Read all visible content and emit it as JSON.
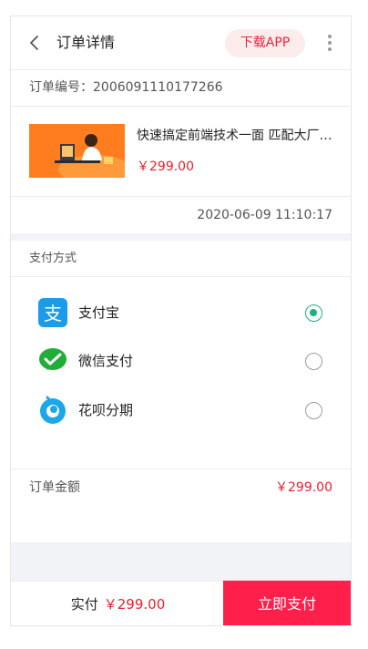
{
  "header": {
    "title": "订单详情",
    "download_label": "下载APP",
    "back_icon": "chevron-left-icon",
    "more_icon": "more-vertical-icon"
  },
  "order": {
    "number_text": "订单编号：2006091110177266",
    "date": "2020-06-09 11:10:17"
  },
  "product": {
    "name": "快速搞定前端技术一面 匹配大厂面试要求",
    "price": "￥299.00",
    "thumb_colors": {
      "bg": "#ff7d1e",
      "accent": "#ffb347"
    }
  },
  "payment": {
    "title": "支付方式",
    "options": [
      {
        "label": "支付宝",
        "icon": "alipay-icon",
        "checked": true
      },
      {
        "label": "微信支付",
        "icon": "wechat-pay-icon",
        "checked": false
      },
      {
        "label": "花呗分期",
        "icon": "huabei-icon",
        "checked": false
      }
    ]
  },
  "amount": {
    "label": "订单金额",
    "value": "￥299.00"
  },
  "bottom": {
    "paid_label": "实付",
    "paid_amount": "￥299.00",
    "pay_now_label": "立即支付"
  },
  "colors": {
    "accent_red": "#e8212d",
    "pay_button": "#ff1f4b",
    "radio_checked": "#19b37b"
  }
}
